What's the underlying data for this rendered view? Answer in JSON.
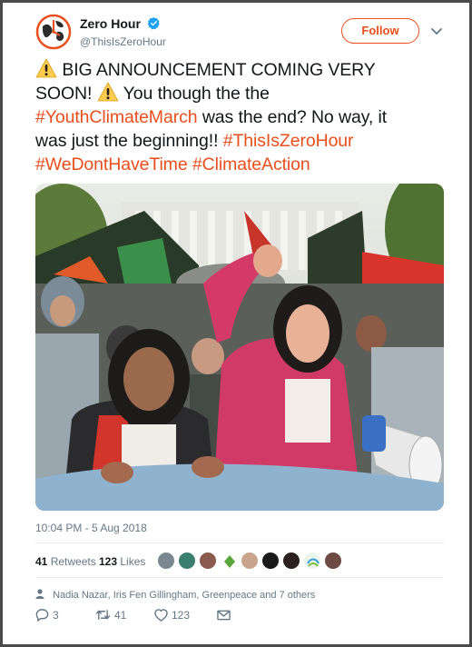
{
  "account": {
    "name": "Zero Hour",
    "handle": "@ThisIsZeroHour",
    "verified_icon": "verified-badge-icon",
    "follow_label": "Follow"
  },
  "tweet": {
    "line1_text": "BIG ANNOUNCEMENT COMING VERY",
    "line2_text_a": "SOON!",
    "line2_text_b": "You though the the",
    "hashtag_youth": "#YouthClimateMarch",
    "line3_text": "was the end? No way, it",
    "line4_text": "was just the beginning!!",
    "hashtag_zerohour": "#ThisIsZeroHour",
    "hashtag_wedonthavetime": "#WeDontHaveTime",
    "hashtag_climateaction": "#ClimateAction"
  },
  "photo": {
    "description_icon": "protest-photo"
  },
  "meta": {
    "timestamp": "10:04 PM - 5 Aug 2018"
  },
  "stats": {
    "retweets_count": "41",
    "retweets_label": "Retweets",
    "likes_count": "123",
    "likes_label": "Likes"
  },
  "context": {
    "text": "Nadia Nazar, Iris Fen Gillingham, Greenpeace and 7 others"
  },
  "actions": {
    "reply_count": "3",
    "retweet_count": "41",
    "like_count": "123"
  },
  "colors": {
    "accent": "#e94e1b",
    "verified": "#1da1f2",
    "muted": "#657786",
    "frame": "#4a4a4a"
  }
}
